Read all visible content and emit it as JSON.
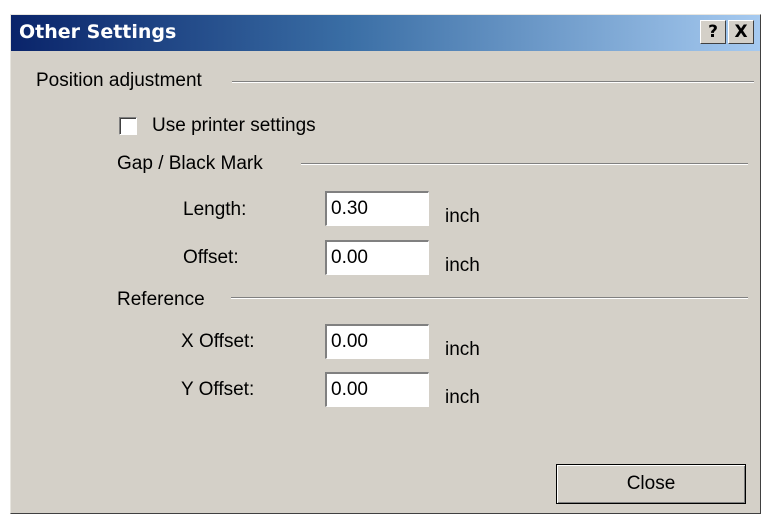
{
  "window": {
    "title": "Other Settings",
    "help_label": "?",
    "close_label": "X"
  },
  "position_adjustment": {
    "label": "Position adjustment",
    "use_printer_settings": {
      "label": "Use printer settings",
      "checked": false
    }
  },
  "gap_black_mark": {
    "label": "Gap / Black Mark",
    "length": {
      "label": "Length:",
      "value": "0.30",
      "unit": "inch"
    },
    "offset": {
      "label": "Offset:",
      "value": "0.00",
      "unit": "inch"
    }
  },
  "reference": {
    "label": "Reference",
    "x_offset": {
      "label": "X Offset:",
      "value": "0.00",
      "unit": "inch"
    },
    "y_offset": {
      "label": "Y Offset:",
      "value": "0.00",
      "unit": "inch"
    }
  },
  "buttons": {
    "close_label": "Close"
  }
}
